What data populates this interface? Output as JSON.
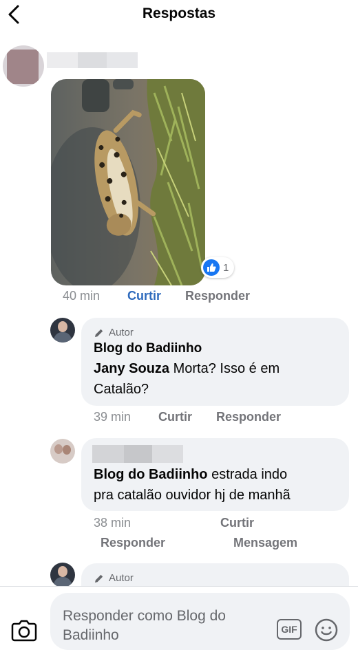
{
  "header": {
    "title": "Respostas"
  },
  "post": {
    "reaction_count": "1",
    "time": "40 min",
    "like_label": "Curtir",
    "reply_label": "Responder"
  },
  "replies": [
    {
      "author_badge": "Autor",
      "name": "Blog do Badiinho",
      "mention": "Jany Souza",
      "text_line1": " Morta? Isso é em",
      "text_line2": "Catalão?",
      "time": "39 min",
      "like_label": "Curtir",
      "reply_label": "Responder"
    },
    {
      "mention": "Blog do Badiinho",
      "text_line1": " estrada indo",
      "text_line2": "pra catalão ouvidor hj de manhã",
      "time": "38 min",
      "like_label": "Curtir",
      "reply_label": "Responder",
      "message_label": "Mensagem"
    },
    {
      "author_badge": "Autor"
    }
  ],
  "footer": {
    "reply_placeholder": "Responder como Blog do Badiinho",
    "gif_label": "GIF"
  },
  "icons": {
    "back": "chevron-left-icon",
    "like": "thumbs-up-icon",
    "pencil": "pencil-icon",
    "camera": "camera-icon",
    "emoji": "smiley-icon"
  },
  "colors": {
    "like_blue": "#1877f2",
    "liked_text": "#2f6bbd",
    "bubble_bg": "#f0f2f5"
  }
}
